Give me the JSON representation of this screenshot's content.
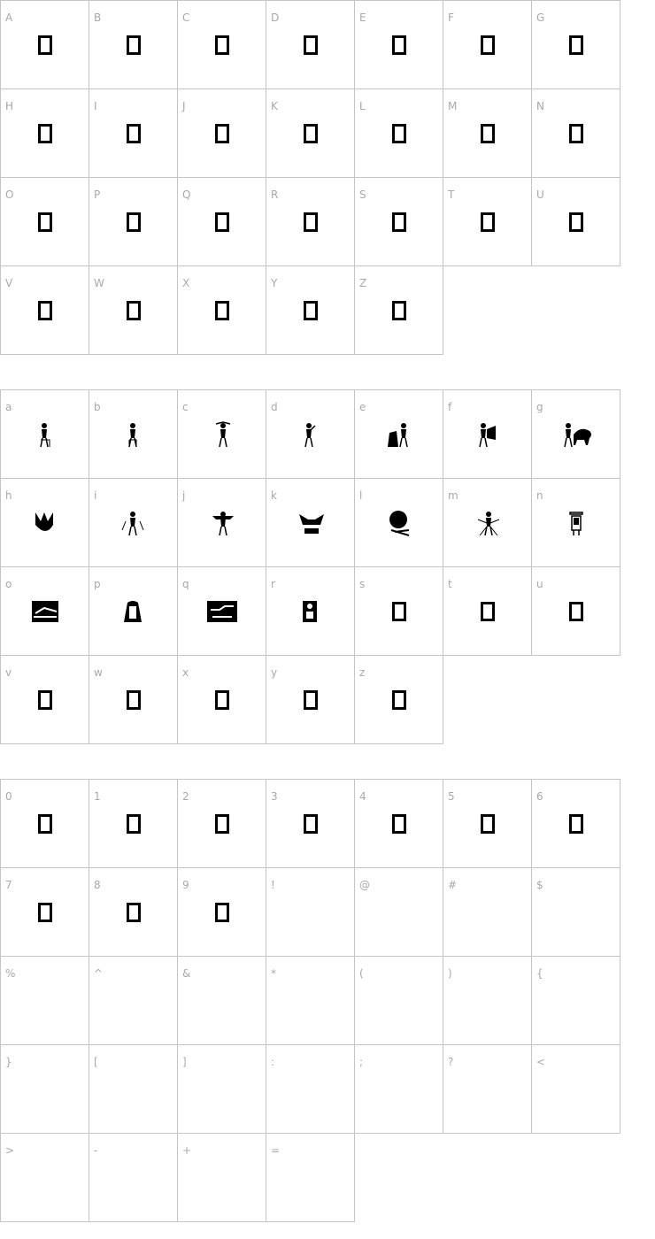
{
  "uppercase": [
    "A",
    "B",
    "C",
    "D",
    "E",
    "F",
    "G",
    "H",
    "I",
    "J",
    "K",
    "L",
    "M",
    "N",
    "O",
    "P",
    "Q",
    "R",
    "S",
    "T",
    "U",
    "V",
    "W",
    "X",
    "Y",
    "Z"
  ],
  "lowercase": [
    "a",
    "b",
    "c",
    "d",
    "e",
    "f",
    "g",
    "h",
    "i",
    "j",
    "k",
    "l",
    "m",
    "n",
    "o",
    "p",
    "q",
    "r",
    "s",
    "t",
    "u",
    "v",
    "w",
    "x",
    "y",
    "z"
  ],
  "symbols": [
    "0",
    "1",
    "2",
    "3",
    "4",
    "5",
    "6",
    "7",
    "8",
    "9",
    "!",
    "@",
    "#",
    "$",
    "%",
    "^",
    "&",
    "*",
    "(",
    ")",
    "{",
    "}",
    "[",
    "]",
    ":",
    ";",
    "?",
    "<",
    ">",
    "-",
    "+",
    "="
  ],
  "glyph_kinds": {
    "uppercase": "missing-box",
    "lowercase_illustrated": [
      "a",
      "b",
      "c",
      "d",
      "e",
      "f",
      "g",
      "h",
      "i",
      "j",
      "k",
      "l",
      "m",
      "n",
      "o",
      "p",
      "q",
      "r"
    ],
    "lowercase_missing": [
      "s",
      "t",
      "u",
      "v",
      "w",
      "x",
      "y",
      "z"
    ],
    "symbols_missing": [
      "0",
      "1",
      "2",
      "3",
      "4",
      "5",
      "6",
      "7",
      "8",
      "9"
    ],
    "symbols_blank": [
      "!",
      "@",
      "#",
      "$",
      "%",
      "^",
      "&",
      "*",
      "(",
      ")",
      "{",
      "}",
      "[",
      "]",
      ":",
      ";",
      "?",
      "<",
      ">",
      "-",
      "+",
      "="
    ]
  },
  "colors": {
    "grid_line": "#c4c4c4",
    "label": "#a8a8a8",
    "glyph": "#000000"
  }
}
